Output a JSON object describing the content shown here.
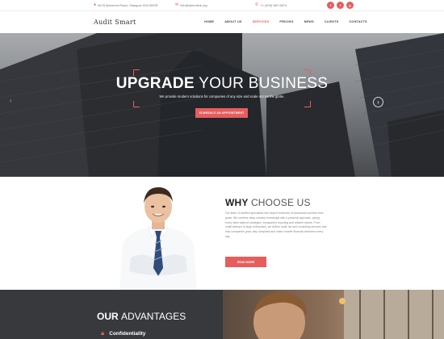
{
  "topbar": {
    "address": "4578 Marmora Road, Glasgow D04 89GR",
    "email": "info@demolink.org",
    "phone": "+1 (409) 987-5874",
    "socials": [
      "f",
      "t",
      "g"
    ]
  },
  "nav": {
    "logo": "Audit Smart",
    "items": [
      "HOME",
      "ABOUT US",
      "SERVICES",
      "PRICING",
      "NEWS",
      "CLIENTS",
      "CONTACTS"
    ],
    "active_index": 2
  },
  "hero": {
    "title_bold": "UPGRADE",
    "title_light": "YOUR BUSINESS",
    "subtitle": "We provide modern solutions for companies of any size and scale across the globe.",
    "button": "SCHEDULE AN APPOINTMENT"
  },
  "why": {
    "title_bold": "WHY",
    "title_light": "CHOOSE US",
    "text": "Our team of certified specialists has helped hundreds of businesses achieve their goals. We combine deep industry knowledge with a personal approach, giving every client tailored strategies, transparent reporting and reliable results. From small startups to large enterprises, we deliver audit, tax and consulting services that help companies grow, stay compliant and make smarter financial decisions every day.",
    "button": "READ MORE"
  },
  "advantages": {
    "title_bold": "OUR",
    "title_light": "ADVANTAGES",
    "items": [
      "Confidentiality"
    ]
  },
  "colors": {
    "accent": "#e75d5d",
    "dark": "#37393c"
  }
}
